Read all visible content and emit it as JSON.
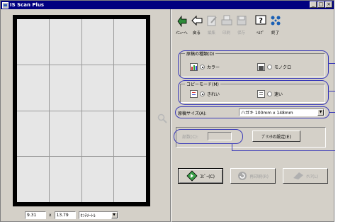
{
  "window": {
    "title": "IS Scan Plus"
  },
  "toolbar": {
    "menu": "ﾒﾆｭｰへ",
    "back": "戻る",
    "edit": "編集",
    "print": "印刷",
    "save": "保存",
    "help": "ﾍﾙﾌﾟ",
    "exit": "終了"
  },
  "doc_type": {
    "title": "原稿の種類(D)",
    "color": "カラー",
    "mono": "モノクロ"
  },
  "copy_mode": {
    "title": "コピーモード(M)",
    "fine": "きれい",
    "fast": "速い"
  },
  "paper_size": {
    "label": "原稿サイズ(A):",
    "value": "ハガキ 100mm x 148mm"
  },
  "copies": {
    "label": "部数(C):",
    "value": ""
  },
  "printer_settings": "ﾌﾟﾘﾝﾀの設定(E)",
  "actions": {
    "copy": "ｺﾋﾟｰ(C)",
    "reset": "再印刷(R)",
    "clear": "ｸﾘｱ(L)"
  },
  "preview": {
    "width": "9.31",
    "times": "x",
    "height": "13.79",
    "unit": "ｾﾝﾁﾒｰﾄﾙ"
  }
}
